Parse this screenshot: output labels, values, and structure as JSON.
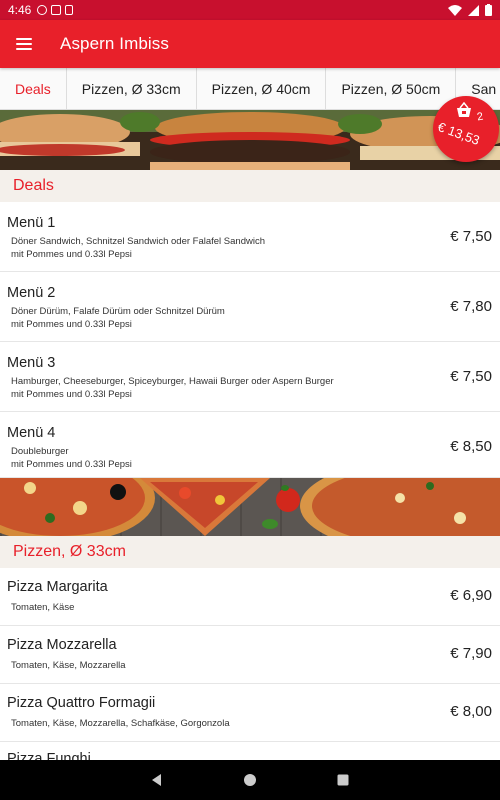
{
  "status": {
    "time": "4:46"
  },
  "app": {
    "title": "Aspern Imbiss"
  },
  "tabs": [
    "Deals",
    "Pizzen, Ø 33cm",
    "Pizzen, Ø 40cm",
    "Pizzen, Ø 50cm",
    "San"
  ],
  "cart": {
    "count": "2",
    "total": "€ 13,53"
  },
  "sections": [
    {
      "title": "Deals",
      "items": [
        {
          "name": "Menü 1",
          "desc1": "Döner Sandwich, Schnitzel Sandwich oder Falafel Sandwich",
          "desc2": "mit Pommes und 0.33l Pepsi",
          "price": "€ 7,50"
        },
        {
          "name": "Menü 2",
          "desc1": "Döner Dürüm, Falafe Dürüm oder Schnitzel Dürüm",
          "desc2": "mit Pommes und 0.33l Pepsi",
          "price": "€ 7,80"
        },
        {
          "name": "Menü 3",
          "desc1": "Hamburger, Cheeseburger, Spiceyburger, Hawaii Burger oder Aspern Burger",
          "desc2": "mit Pommes und 0.33l Pepsi",
          "price": "€ 7,50"
        },
        {
          "name": "Menü 4",
          "desc1": "Doubleburger",
          "desc2": "mit Pommes und 0.33l Pepsi",
          "price": "€ 8,50"
        }
      ]
    },
    {
      "title": "Pizzen, Ø 33cm",
      "items": [
        {
          "name": "Pizza Margarita",
          "desc1": "Tomaten, Käse",
          "price": "€ 6,90"
        },
        {
          "name": "Pizza Mozzarella",
          "desc1": "Tomaten, Käse, Mozzarella",
          "price": "€ 7,90"
        },
        {
          "name": "Pizza Quattro Formagii",
          "desc1": "Tomaten, Käse, Mozzarella, Schafkäse, Gorgonzola",
          "price": "€ 8,00"
        },
        {
          "name": "Pizza Funghi"
        }
      ]
    }
  ],
  "colors": {
    "primary": "#e8202a",
    "statusbar": "#c8102e",
    "section_bg": "#f4f0eb"
  }
}
